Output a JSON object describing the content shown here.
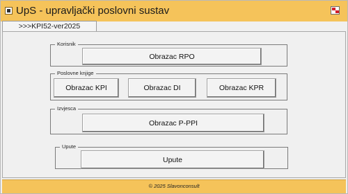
{
  "window": {
    "title": "UpS - upravljački poslovni sustav",
    "app_icon": "app-window-icon",
    "control_icon": "restore-window-icon"
  },
  "tab": {
    "label": ">>>KPI52-ver2025"
  },
  "groups": {
    "korisnik": {
      "legend": "Korisnik",
      "buttons": [
        "Obrazac RPO"
      ]
    },
    "poslovne_knjige": {
      "legend": "Poslovne knjige",
      "buttons": [
        "Obrazac KPI",
        "Obrazac DI",
        "Obrazac KPR"
      ]
    },
    "izvjesca": {
      "legend": "Izvjesca",
      "buttons": [
        "Obrazac P-PPI"
      ]
    },
    "upute": {
      "legend": "Upute",
      "buttons": [
        "Upute"
      ]
    }
  },
  "footer": {
    "text": "© 2025 Slavonconsult"
  },
  "colors": {
    "title_bar": "#f5c35a",
    "background": "#f0f0f0",
    "control_icon_red": "#d21f2a"
  }
}
